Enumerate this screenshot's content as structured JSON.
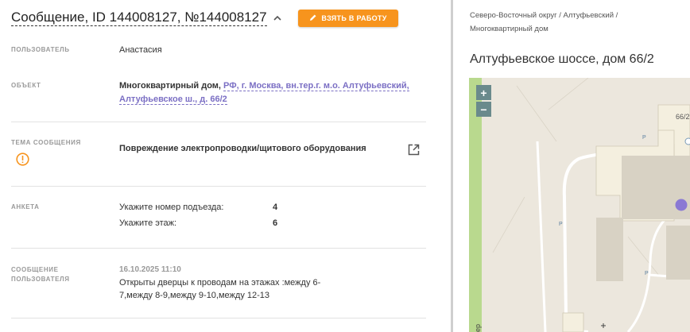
{
  "header": {
    "title": "Сообщение, ID 144008127, №144008127",
    "take_button": "ВЗЯТЬ В РАБОТУ"
  },
  "fields": {
    "user_label": "ПОЛЬЗОВАТЕЛЬ",
    "user_value": "Анастасия",
    "object_label": "ОБЪЕКТ",
    "object_type": "Многоквартирный дом,",
    "object_address_line1": "РФ, г. Москва, вн.тер.г. м.о. Алтуфьевский,",
    "object_address_line2": "Алтуфьевское ш., д. 66/2",
    "topic_label": "ТЕМА СООБЩЕНИЯ",
    "topic_value": "Повреждение электропроводки/щитового оборудования",
    "survey_label": "АНКЕТА",
    "survey": [
      {
        "question": "Укажите номер подъезда:",
        "answer": "4"
      },
      {
        "question": "Укажите этаж:",
        "answer": "6"
      }
    ],
    "message_label_line1": "СООБЩЕНИЕ",
    "message_label_line2": "ПОЛЬЗОВАТЕЛЯ",
    "message_date": "16.10.2025 11:10",
    "message_text": "Открыты дверцы к проводам на этажах :между 6-7,между 8-9,между 9-10,между 12-13"
  },
  "location": {
    "breadcrumb_line1": "Северо-Восточный округ / Алтуфьевский /",
    "breadcrumb_line2": "Многоквартирный дом",
    "address": "Алтуфьевское шоссе, дом 66/2"
  },
  "map": {
    "zoom_in": "+",
    "zoom_out": "−",
    "building_label": "66/2",
    "parking_label": "P",
    "street_label_fragment": "ер"
  },
  "colors": {
    "accent_orange": "#f7941d",
    "link_purple": "#7b6fc4",
    "marker_purple": "#8a79d4",
    "park_green": "#b9d98e"
  }
}
